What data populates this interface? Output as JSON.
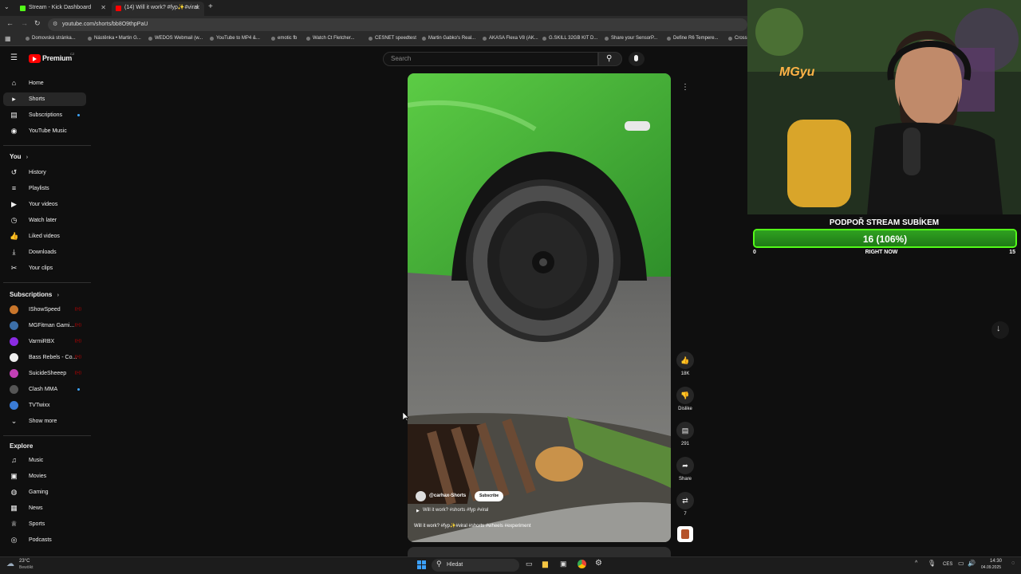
{
  "browser": {
    "tabs": [
      {
        "label": "Stream - Kick Dashboard",
        "color": "#53fc18"
      },
      {
        "label": "(14) Will it work? #fyp✨#viral",
        "color": "#ff0000"
      }
    ],
    "url": "youtube.com/shorts/bb8O9thpPaU",
    "bookmarks": [
      "Domovská stránka...",
      "Nástěnka • Martin G...",
      "WEDOS Webmail (w...",
      "YouTube to MP4 &...",
      "emotic fb",
      "Watch Ct Fletcher...",
      "CESNET speedtest",
      "Martin Gabko's Real...",
      "AKASA Flexa V8 (AK...",
      "G.SKILL 32GB KIT D...",
      "Share your SensorP...",
      "Define R6 Tempere...",
      "Crossi"
    ]
  },
  "youtube": {
    "logo": "Premium",
    "logo_suffix": "CZ",
    "search_placeholder": "Search",
    "nav_main": [
      {
        "label": "Home",
        "icon": "⌂"
      },
      {
        "label": "Shorts",
        "icon": "▸"
      },
      {
        "label": "Subscriptions",
        "icon": "▤"
      },
      {
        "label": "YouTube Music",
        "icon": "◉"
      }
    ],
    "you_heading": "You",
    "nav_you": [
      {
        "label": "History",
        "icon": "↺"
      },
      {
        "label": "Playlists",
        "icon": "≡"
      },
      {
        "label": "Your videos",
        "icon": "▶"
      },
      {
        "label": "Watch later",
        "icon": "◷"
      },
      {
        "label": "Liked videos",
        "icon": "👍"
      },
      {
        "label": "Downloads",
        "icon": "⤓"
      },
      {
        "label": "Your clips",
        "icon": "✂"
      }
    ],
    "subscriptions_heading": "Subscriptions",
    "subscriptions": [
      {
        "label": "IShowSpeed",
        "color": "#c9762b"
      },
      {
        "label": "MGFitman Gami...",
        "color": "#3c6fa8"
      },
      {
        "label": "VarmiRBX",
        "color": "#8a2be2"
      },
      {
        "label": "Bass Rebels - Co...",
        "color": "#eeeeee"
      },
      {
        "label": "SuicideSheeep",
        "color": "#c23fb5"
      },
      {
        "label": "Clash MMA",
        "color": "#555555"
      },
      {
        "label": "TVTwixx",
        "color": "#3a7bd5"
      }
    ],
    "show_more": "Show more",
    "explore_heading": "Explore",
    "nav_explore": [
      {
        "label": "Music",
        "icon": "♫"
      },
      {
        "label": "Movies",
        "icon": "▣"
      },
      {
        "label": "Gaming",
        "icon": "◍"
      },
      {
        "label": "News",
        "icon": "▦"
      },
      {
        "label": "Sports",
        "icon": "♕"
      },
      {
        "label": "Podcasts",
        "icon": "◎"
      }
    ],
    "short": {
      "channel": "@carhax-Shorts",
      "subscribe": "Subscribe",
      "playlist": "Will it work? #shorts #fyp #viral",
      "title": "Will it work? #fyp✨#viral #shorts #wheels #experiment",
      "likes": "18K",
      "dislike": "Dislike",
      "comments": "291",
      "share": "Share",
      "remix": "7"
    }
  },
  "overlay": {
    "goal_title": "PODPOŘ STREAM SUBÍKEM",
    "goal_value": "16 (106%)",
    "goal_progress": 1.0,
    "goal_min": "0",
    "goal_max": "15",
    "goal_sub": "RIGHT NOW",
    "cam_sign": "MGyu"
  },
  "taskbar": {
    "weather_temp": "23°C",
    "weather_text": "Bewölkt",
    "search": "Hledat",
    "lang": "CES",
    "time": "14:30",
    "date": "04.09.2025"
  },
  "colors": {
    "accent_green": "#53fc18",
    "yt_red": "#ff0000",
    "car_green": "#4fbf3a"
  }
}
